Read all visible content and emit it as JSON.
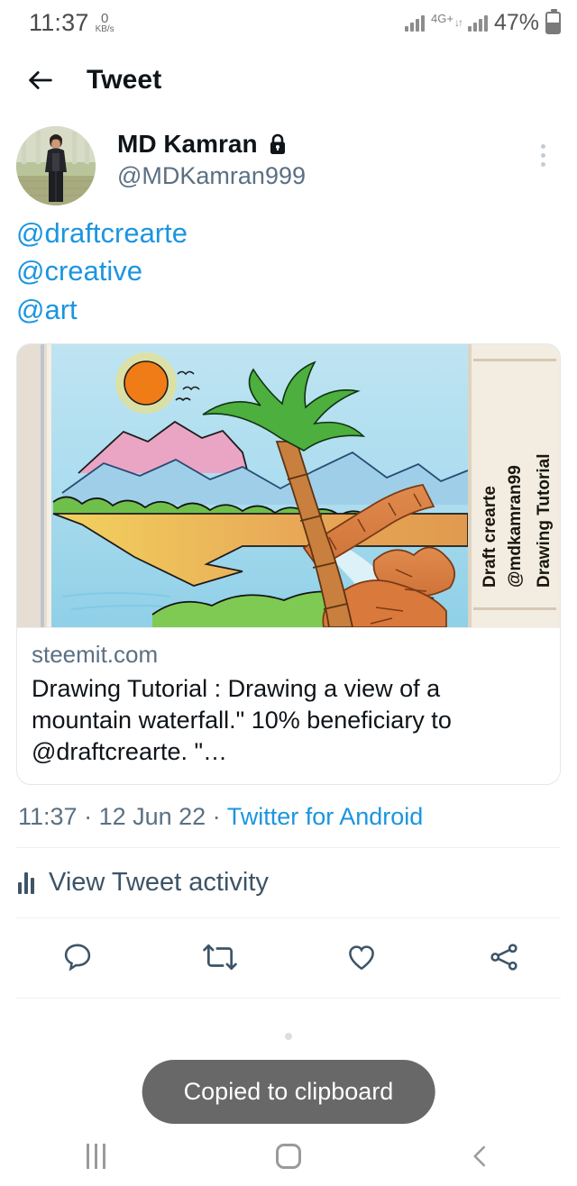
{
  "status_bar": {
    "time": "11:37",
    "net_speed_value": "0",
    "net_speed_unit": "KB/s",
    "network_type": "4G+",
    "battery_percent": "47%"
  },
  "app_header": {
    "title": "Tweet",
    "back_icon": "arrow-left-icon"
  },
  "tweet": {
    "author_name": "MD Kamran",
    "author_badge_icon": "lock-icon",
    "author_handle": "@MDKamran999",
    "overflow_icon": "more-vertical-icon",
    "body_lines": [
      "@draftcrearte",
      "@creative",
      "@art"
    ],
    "link_card": {
      "domain": "steemit.com",
      "title": "Drawing Tutorial : Drawing a view of a mountain waterfall.\" 10% beneficiary to @draftcrearte. \"…",
      "image_alt": "Watercolor drawing of a mountain waterfall landscape with a palm tree",
      "image_handwriting": [
        "Draft crearte",
        "@mdkamran99",
        "Drawing Tutorial"
      ]
    },
    "meta": {
      "time": "11:37",
      "separator": " · ",
      "date": "12 Jun 22",
      "source": "Twitter for Android"
    },
    "activity": {
      "icon": "bar-chart-icon",
      "label": "View Tweet activity"
    },
    "actions": [
      {
        "name": "reply",
        "icon": "reply-icon"
      },
      {
        "name": "retweet",
        "icon": "retweet-icon"
      },
      {
        "name": "like",
        "icon": "heart-icon"
      },
      {
        "name": "share",
        "icon": "share-icon"
      }
    ]
  },
  "toast": {
    "message": "Copied to clipboard"
  },
  "nav_bar": {
    "recents_icon": "recents-icon",
    "home_icon": "home-icon",
    "back_icon": "chevron-left-icon"
  },
  "colors": {
    "link_blue": "#1b95e0",
    "text_primary": "#0f1419",
    "text_secondary": "#5b7083",
    "toast_bg": "#686868"
  }
}
